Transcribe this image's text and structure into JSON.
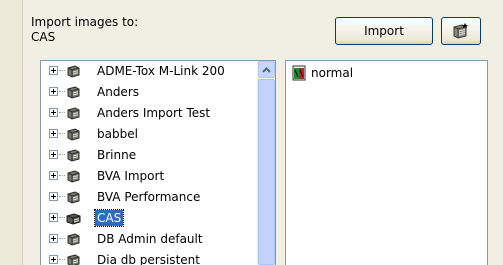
{
  "import_label": "Import images to:\nCAS",
  "buttons": {
    "import_label": "Import"
  },
  "tree": {
    "items": [
      {
        "label": "ADME-Tox M-Link 200"
      },
      {
        "label": "Anders"
      },
      {
        "label": "Anders Import Test"
      },
      {
        "label": "babbel"
      },
      {
        "label": "Brinne"
      },
      {
        "label": "BVA Import"
      },
      {
        "label": "BVA Performance"
      },
      {
        "label": "CAS",
        "selected": true
      },
      {
        "label": "DB Admin default"
      },
      {
        "label": "Dia db persistent"
      }
    ]
  },
  "images": {
    "items": [
      {
        "label": "normal"
      }
    ]
  },
  "colors": {
    "selection": "#316ac5",
    "scrollbar": "#c1d3fb",
    "background": "#f1efe4"
  }
}
